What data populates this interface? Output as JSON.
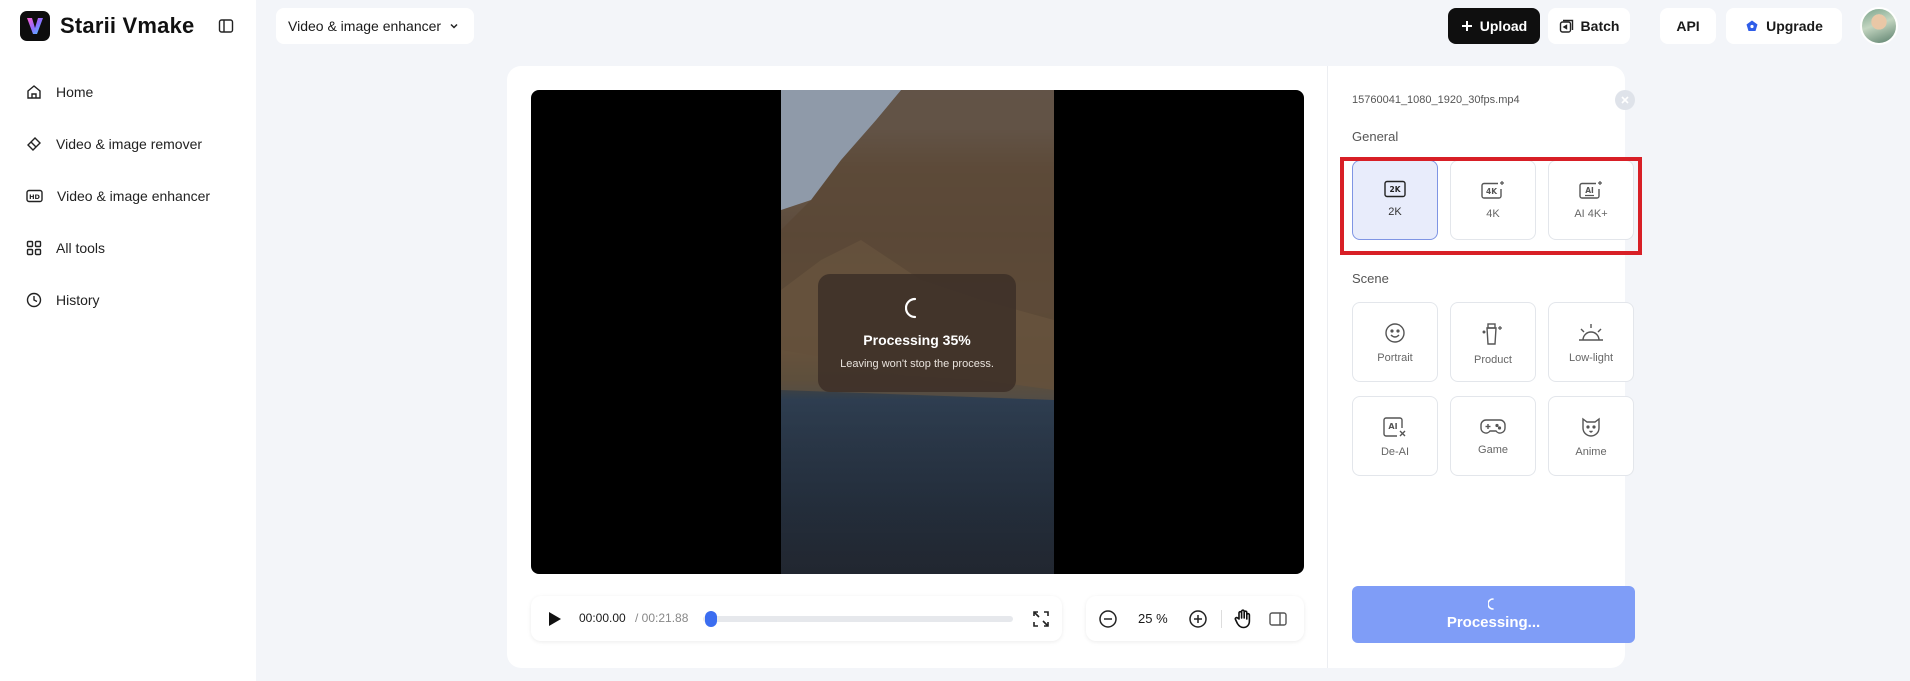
{
  "app": {
    "name": "Starii Vmake"
  },
  "sidebar": {
    "items": [
      {
        "label": "Home",
        "icon": "home-icon"
      },
      {
        "label": "Video & image remover",
        "icon": "eraser-icon"
      },
      {
        "label": "Video & image enhancer",
        "icon": "hd-icon"
      },
      {
        "label": "All tools",
        "icon": "grid-icon"
      },
      {
        "label": "History",
        "icon": "clock-icon"
      }
    ]
  },
  "topbar": {
    "tool_selector": "Video & image enhancer",
    "upload_label": "Upload",
    "batch_label": "Batch",
    "api_label": "API",
    "upgrade_label": "Upgrade"
  },
  "player": {
    "processing_title": "Processing 35%",
    "processing_progress": 0.35,
    "processing_note": "Leaving won't stop the process.",
    "current_time": "00:00.00",
    "total_time": "/ 00:21.88",
    "playhead_progress": 0.0,
    "zoom_level": "25 %"
  },
  "panel": {
    "file_name": "15760041_1080_1920_30fps.mp4",
    "general_label": "General",
    "general_options": [
      {
        "label": "2K",
        "icon": "2k-icon",
        "selected": true
      },
      {
        "label": "4K",
        "icon": "4k-sparkle-icon",
        "selected": false
      },
      {
        "label": "AI 4K+",
        "icon": "ai-sparkle-icon",
        "selected": false
      }
    ],
    "scene_label": "Scene",
    "scene_options": [
      {
        "label": "Portrait",
        "icon": "smile-face-icon"
      },
      {
        "label": "Product",
        "icon": "product-bottle-icon"
      },
      {
        "label": "Low-light",
        "icon": "sunrise-icon"
      },
      {
        "label": "De-AI",
        "icon": "ai-remove-icon"
      },
      {
        "label": "Game",
        "icon": "gamepad-icon"
      },
      {
        "label": "Anime",
        "icon": "anime-bear-icon"
      }
    ],
    "action_label": "Processing..."
  },
  "colors": {
    "accent": "#3b6df0",
    "action_button": "#7f9df7",
    "selected_option_bg": "#e8ecfb",
    "annotation_red": "#d81f26"
  }
}
